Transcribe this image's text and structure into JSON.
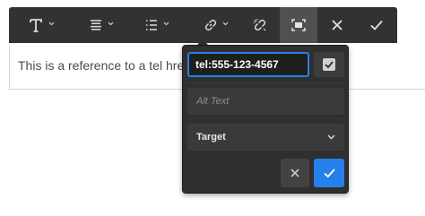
{
  "toolbar": {
    "icons": [
      "text-format-icon",
      "paragraph-align-icon",
      "list-icon",
      "link-icon",
      "unlink-icon",
      "fullscreen-icon",
      "close-icon",
      "check-icon"
    ]
  },
  "editor": {
    "text": "This is a reference to a tel href"
  },
  "link_popover": {
    "href_value": "tel:555-123-4567",
    "alt_text_placeholder": "Alt Text",
    "target_label": "Target",
    "accent_color": "#2680eb"
  }
}
